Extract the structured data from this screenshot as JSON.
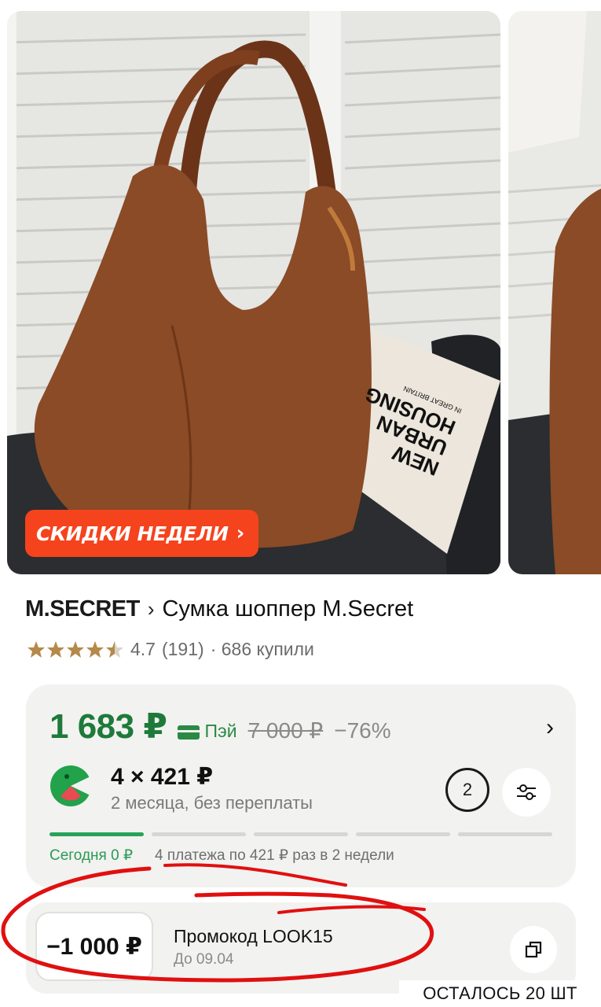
{
  "gallery": {
    "sale_badge": "СКИДКИ НЕДЕЛИ",
    "book_lines": [
      "NEW",
      "URBAN",
      "HOUSING"
    ],
    "book_small": "IN GREAT BRITAIN"
  },
  "product": {
    "brand": "M.SECRET",
    "separator": "›",
    "name": "Сумка шоппер M.Secret",
    "rating": "4.7",
    "reviews": "(191)",
    "bought": "· 686 купили",
    "stars": 4.5
  },
  "price": {
    "current": "1 683 ₽",
    "pay_label": "Пэй",
    "old": "7 000 ₽",
    "discount": "−76%",
    "split_amount": "4 × 421 ₽",
    "split_sub": "2 месяца, без переплаты",
    "months": "2",
    "today": "Сегодня 0 ₽",
    "schedule": "4 платежа по 421 ₽ раз в 2 недели",
    "progress_segments": 5,
    "progress_active": 1
  },
  "promo": {
    "amount": "−1 000 ₽",
    "title": "Промокод LOOK15",
    "until": "До 09.04"
  },
  "stock": "ОСТАЛОСЬ 20 ШТ",
  "colors": {
    "accent_green": "#1e7a3a",
    "sale_orange": "#f5431d",
    "annotation_red": "#e01010"
  }
}
